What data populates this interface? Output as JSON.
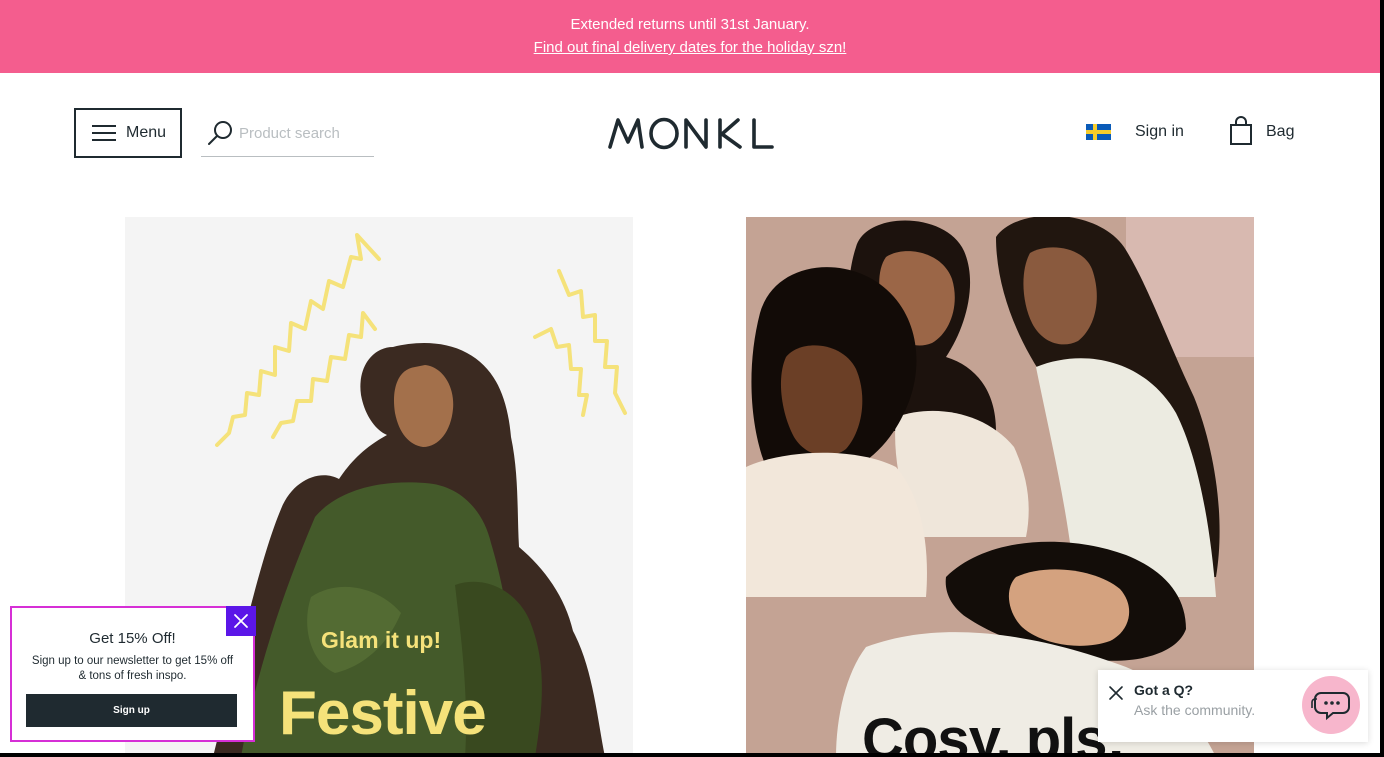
{
  "promo": {
    "line1": "Extended returns until 31st January.",
    "line2": "Find out final delivery dates for the holiday szn!"
  },
  "header": {
    "menu_label": "Menu",
    "search_placeholder": "Product search",
    "logo_text": "MONKI",
    "signin_label": "Sign in",
    "bag_label": "Bag",
    "country_flag": "sweden-flag-icon"
  },
  "hero": {
    "tiles": [
      {
        "kicker": "Glam it up!",
        "headline": "Festive",
        "accent_color": "#f5e27a"
      },
      {
        "headline": "Cosy, pls:"
      }
    ]
  },
  "newsletter": {
    "title": "Get 15% Off!",
    "body": "Sign up to our newsletter to get 15% off & tons of fresh inspo.",
    "cta_label": "Sign up",
    "close_icon": "close-icon"
  },
  "chat": {
    "title": "Got a Q?",
    "subtitle": "Ask the community.",
    "icon": "chat-bubble-icon"
  },
  "colors": {
    "promo_bg": "#f45d8e",
    "brand_dark": "#1f2a30",
    "popup_border": "#d62fd6",
    "popup_close_bg": "#5b16e8",
    "chat_bubble": "#f7b6cc"
  }
}
